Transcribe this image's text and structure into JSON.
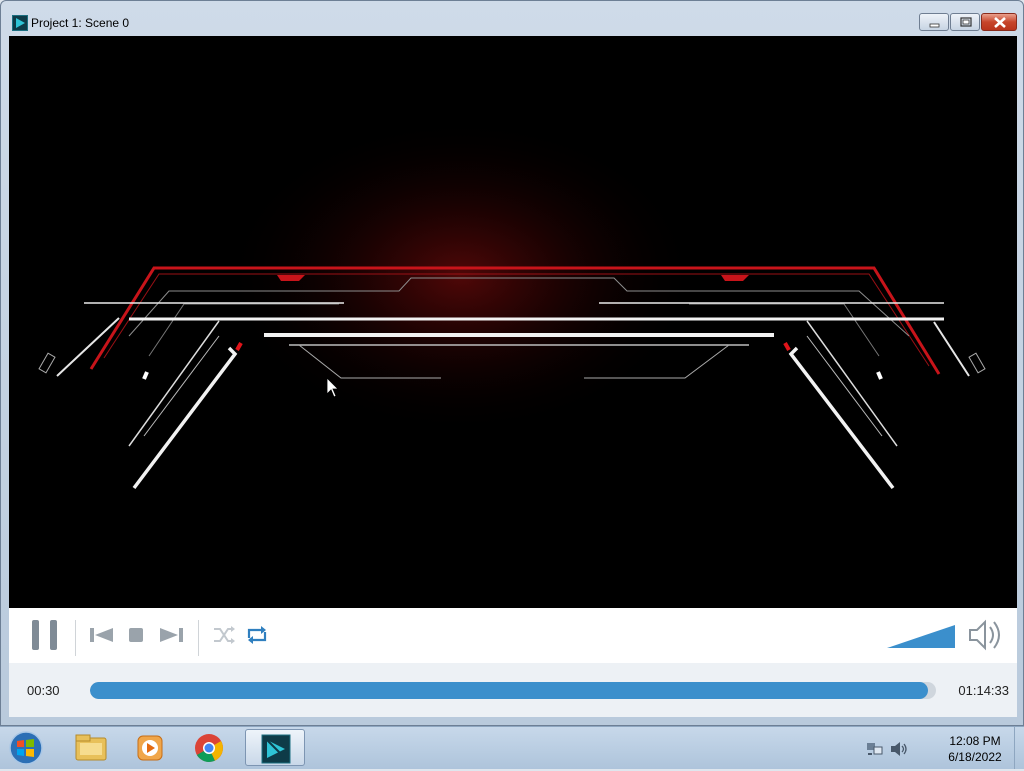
{
  "window": {
    "title": "Project 1: Scene 0"
  },
  "player": {
    "current_time": "00:30",
    "total_time": "01:14:33",
    "progress_fraction": 0.99,
    "volume_fraction": 1.0,
    "controls": [
      "pause-icon",
      "previous-icon",
      "stop-icon",
      "next-icon",
      "shuffle-icon",
      "repeat-icon",
      "volume-icon"
    ]
  },
  "colors": {
    "accent": "#3b8fcc",
    "video_red": "#c8141a",
    "video_white": "#f2f2f2"
  },
  "taskbar": {
    "pinned": [
      "start-orb-icon",
      "file-explorer-icon",
      "media-player-icon",
      "chrome-icon",
      "video-editor-icon"
    ],
    "tray": [
      "network-icon",
      "speaker-icon"
    ],
    "time": "12:08 PM",
    "date": "6/18/2022"
  }
}
